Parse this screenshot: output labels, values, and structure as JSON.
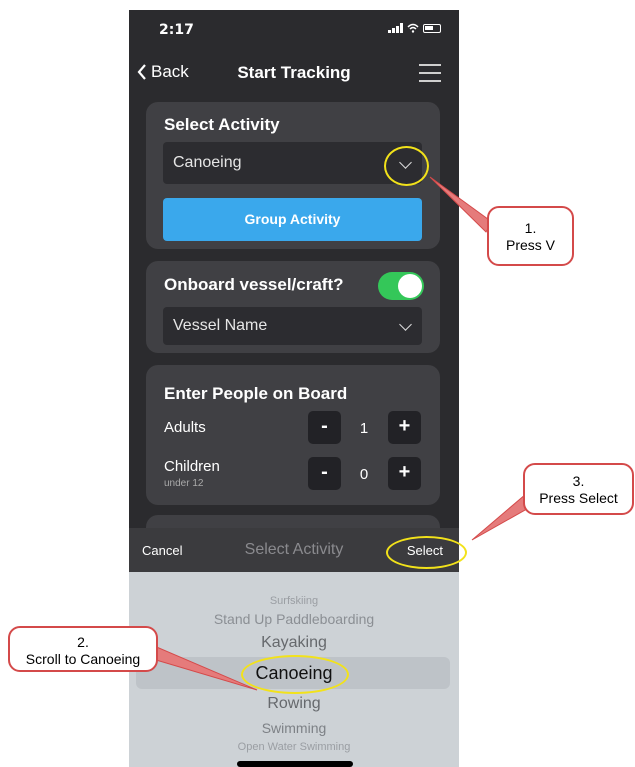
{
  "status": {
    "time": "2:17"
  },
  "nav": {
    "back_label": "Back",
    "title": "Start Tracking"
  },
  "activity_card": {
    "title": "Select Activity",
    "selected": "Canoeing",
    "group_button": "Group Activity"
  },
  "vessel_card": {
    "title": "Onboard vessel/craft?",
    "toggle_on": true,
    "vessel_placeholder": "Vessel Name"
  },
  "people_card": {
    "title": "Enter People on Board",
    "rows": [
      {
        "label": "Adults",
        "sub": "",
        "value": "1"
      },
      {
        "label": "Children",
        "sub": "under 12",
        "value": "0"
      }
    ],
    "minus": "-",
    "plus": "+"
  },
  "picker_bar": {
    "cancel": "Cancel",
    "title": "Select Activity",
    "select": "Select"
  },
  "picker_items": [
    "Surfskiing",
    "Stand Up Paddleboarding",
    "Kayaking",
    "Canoeing",
    "Rowing",
    "Swimming",
    "Open Water Swimming"
  ],
  "callouts": {
    "one": [
      "1.",
      "Press V"
    ],
    "two": [
      "2.",
      "Scroll to Canoeing"
    ],
    "three": [
      "3.",
      "Press Select"
    ]
  },
  "colors": {
    "accent": "#3aa8ec",
    "toggle": "#34c759",
    "highlight": "#f2e21a",
    "callout_border": "#d44a4a"
  }
}
